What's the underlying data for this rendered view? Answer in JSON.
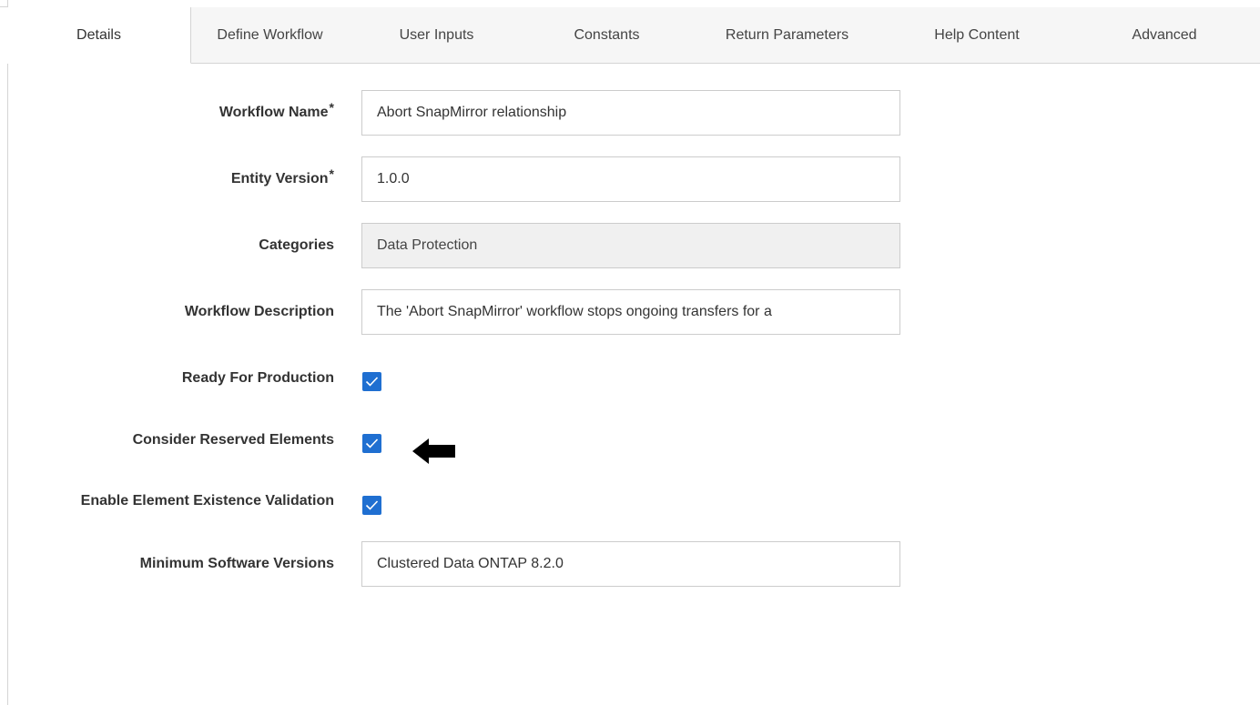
{
  "tabs": [
    {
      "label": "Details",
      "active": true
    },
    {
      "label": "Define Workflow",
      "active": false
    },
    {
      "label": "User Inputs",
      "active": false
    },
    {
      "label": "Constants",
      "active": false
    },
    {
      "label": "Return Parameters",
      "active": false
    },
    {
      "label": "Help Content",
      "active": false
    },
    {
      "label": "Advanced",
      "active": false
    }
  ],
  "form": {
    "workflow_name": {
      "label": "Workflow Name",
      "required_mark": "*",
      "value": "Abort SnapMirror relationship"
    },
    "entity_version": {
      "label": "Entity Version",
      "required_mark": "*",
      "value": "1.0.0"
    },
    "categories": {
      "label": "Categories",
      "value": "Data Protection"
    },
    "workflow_description": {
      "label": "Workflow Description",
      "value": "The 'Abort SnapMirror' workflow stops ongoing transfers for a"
    },
    "ready_for_production": {
      "label": "Ready For Production",
      "checked": true
    },
    "consider_reserved_elements": {
      "label": "Consider Reserved Elements",
      "checked": true
    },
    "enable_element_existence_validation": {
      "label": "Enable Element Existence Validation",
      "checked": true
    },
    "minimum_software_versions": {
      "label": "Minimum Software Versions",
      "value": "Clustered Data ONTAP 8.2.0"
    }
  },
  "colors": {
    "checkbox": "#1f6fd1",
    "tab_inactive_bg": "#f6f6f6",
    "border": "#d4d4d4",
    "disabled_field_bg": "#f0f0f0"
  },
  "icons": {
    "checkmark": "check-icon",
    "pointer_arrow": "left-arrow-icon"
  }
}
